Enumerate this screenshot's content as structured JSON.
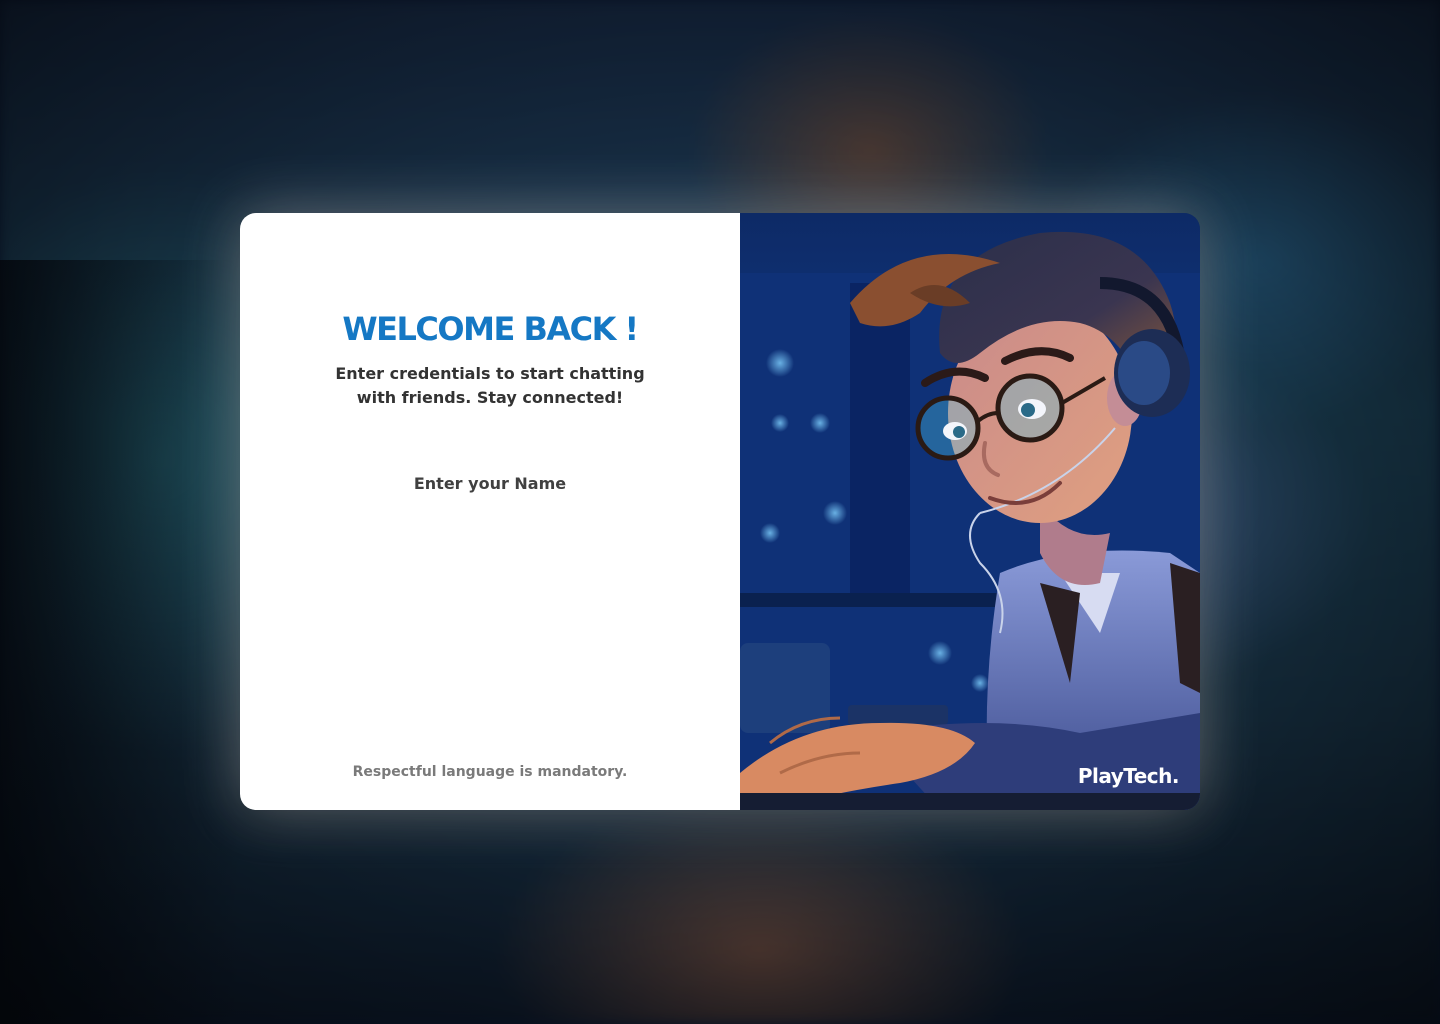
{
  "login": {
    "title": "WELCOME BACK !",
    "subtitle": "Enter credentials to start chatting with friends. Stay connected!",
    "name_label": "Enter your Name",
    "name_value": "",
    "footer_note": "Respectful language is mandatory."
  },
  "illustration": {
    "brand": "PlayTech.",
    "subject": "cartoon developer with headphones and glasses typing at laptop"
  },
  "colors": {
    "accent": "#1578c4",
    "text": "#333333",
    "muted": "#7a7a7a",
    "panel_bg": "#ffffff"
  }
}
